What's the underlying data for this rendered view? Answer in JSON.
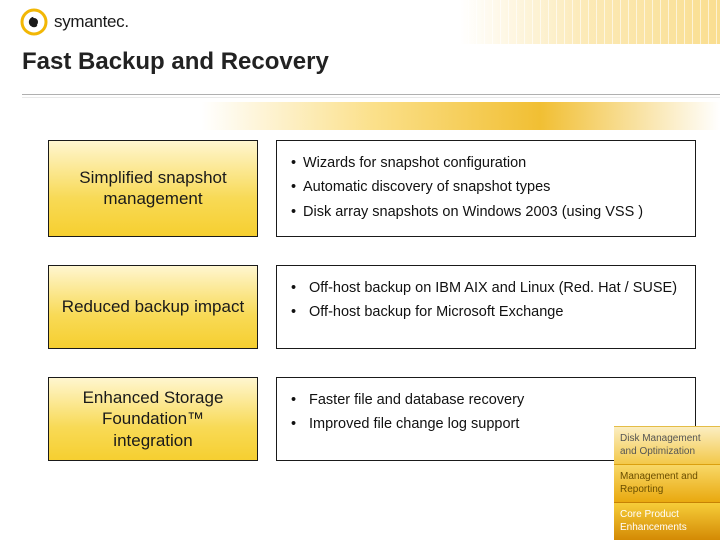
{
  "brand": "symantec.",
  "title": "Fast Backup and Recovery",
  "rows": [
    {
      "heading": "Simplified snapshot management",
      "bullets": [
        "Wizards for snapshot configuration",
        "Automatic discovery of snapshot types",
        "Disk array snapshots on Windows 2003 (using VSS )"
      ]
    },
    {
      "heading": "Reduced backup impact",
      "bullets": [
        "Off-host backup on IBM AIX and Linux (Red. Hat / SUSE)",
        "Off-host backup for Microsoft Exchange"
      ]
    },
    {
      "heading": "Enhanced Storage Foundation™ integration",
      "bullets": [
        "Faster file and database recovery",
        "Improved file change log support"
      ]
    }
  ],
  "sidebar": [
    "Disk Management and Optimization",
    "Management and Reporting",
    "Core Product Enhancements"
  ]
}
